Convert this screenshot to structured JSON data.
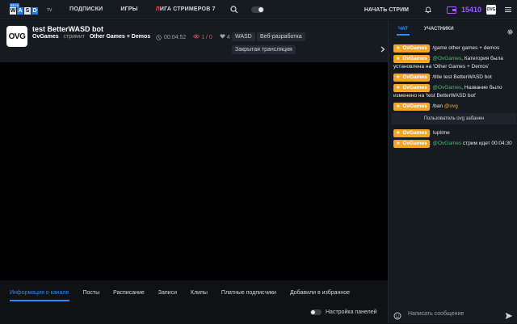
{
  "topbar": {
    "logo_beta": "BETA",
    "logo_letters": [
      "W",
      "A",
      "S",
      "D"
    ],
    "logo_tv": "TV",
    "nav": [
      "ПОДПИСКИ",
      "ИГРЫ"
    ],
    "ladder_prefix": "Л",
    "ladder_rest": "ИГА СТРИМЕРОВ 7",
    "start_stream": "НАЧАТЬ СТРИМ",
    "coins": "15410",
    "avatar": "OVG"
  },
  "stream": {
    "channel_avatar": "OVG",
    "title": "test BetterWASD bot",
    "channel": "OvGames",
    "streams_word": "стримит",
    "game": "Other Games + Demos",
    "uptime": "00:04:52",
    "viewers": "1 / 0",
    "likes": "4",
    "tags": [
      "WASD",
      "Веб-разработка",
      "Закрытая трансляция"
    ]
  },
  "tabs": [
    "Информация о канале",
    "Посты",
    "Расписание",
    "Записи",
    "Клипы",
    "Платные подписчики",
    "Добавили в избранное"
  ],
  "panel_settings": "Настройка панелей",
  "chat": {
    "tabs": [
      "ЧАТ",
      "УЧАСТНИКИ"
    ],
    "badge_name": "OvGames",
    "messages": [
      {
        "text": "/game other games + demos"
      },
      {
        "mention": "@OvGames",
        "text": ", Категория была установлена на 'Other Games + Demos'"
      },
      {
        "text": "/title test BetterWASD bot"
      },
      {
        "mention": "@OvGames",
        "text": ", Название было изменено на 'test BetterWASD bot'"
      },
      {
        "text": "/ban ",
        "mention_y": "@ovg"
      }
    ],
    "system": "Пользователь ovg забанен",
    "messages2": [
      {
        "text": "!uptime"
      },
      {
        "mention": "@OvGames",
        "text": " стрим идет 00:04:30"
      }
    ],
    "input_placeholder": "Написать сообщение"
  }
}
